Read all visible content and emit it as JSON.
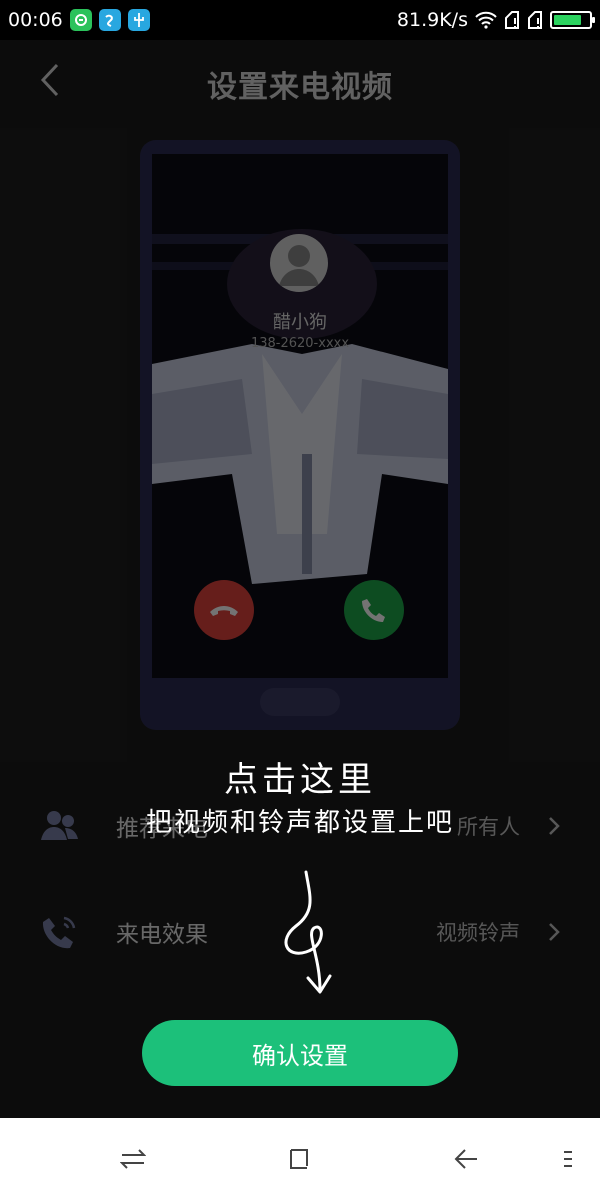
{
  "status_bar": {
    "time": "00:06",
    "network_speed": "81.9K/s",
    "battery_level": 0.8,
    "colors": {
      "app_green": "#2bc25b",
      "app_blue": "#28a7e0",
      "battery_fill": "#2bd35f"
    },
    "icons": [
      "app-badge-icon",
      "app-badge-icon",
      "usb-icon",
      "wifi-icon",
      "signal-icon",
      "signal-icon",
      "battery-icon"
    ]
  },
  "header": {
    "title": "设置来电视频",
    "back_icon": "chevron-left-icon"
  },
  "preview": {
    "caller_name": "醋小狗",
    "caller_number": "138-2620-xxxx",
    "decline_color": "#e2443c",
    "accept_color": "#1ea84a"
  },
  "settings": {
    "row1": {
      "label": "推荐来电",
      "value": "所有人",
      "icon": "contacts-icon"
    },
    "row2": {
      "label": "来电效果",
      "value": "视频铃声",
      "icon": "ringing-phone-icon"
    }
  },
  "overlay": {
    "line1": "点击这里",
    "line2": "把视频和铃声都设置上吧"
  },
  "confirm_button": {
    "label": "确认设置",
    "color": "#1cc07a"
  },
  "nav_bar": {
    "icons": [
      "switch-icon",
      "square-icon",
      "back-arrow-icon",
      "menu-icon"
    ]
  }
}
